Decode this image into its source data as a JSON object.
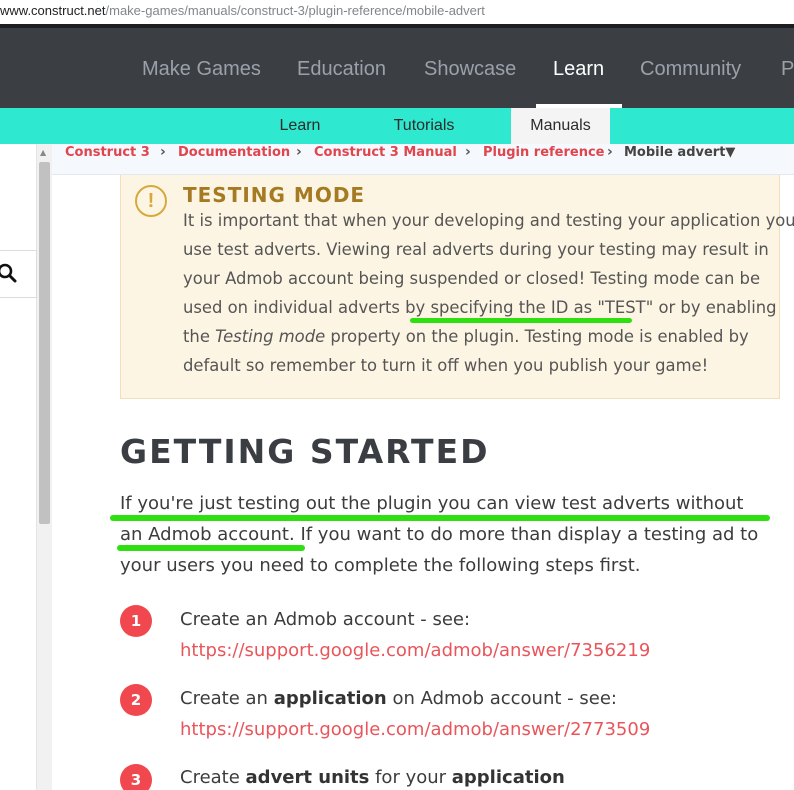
{
  "address_bar": {
    "domain": "www.construct.net",
    "path": "/make-games/manuals/construct-3/plugin-reference/mobile-advert"
  },
  "main_nav": {
    "items": [
      {
        "label": "Make Games"
      },
      {
        "label": "Education"
      },
      {
        "label": "Showcase"
      },
      {
        "label": "Learn"
      },
      {
        "label": "Community"
      },
      {
        "label": "P"
      }
    ],
    "active": "Learn"
  },
  "sub_nav": {
    "items": [
      {
        "label": "Learn"
      },
      {
        "label": "Tutorials"
      },
      {
        "label": "Manuals"
      }
    ],
    "active": "Manuals"
  },
  "breadcrumb": {
    "items": [
      {
        "label": "Construct 3"
      },
      {
        "label": "Documentation"
      },
      {
        "label": "Construct 3 Manual"
      },
      {
        "label": "Plugin reference"
      }
    ],
    "current": "Mobile advert▼"
  },
  "notice": {
    "icon": "!",
    "title": "TESTING MODE",
    "lines": [
      "It is important that when your developing and testing your application you",
      "use test adverts. Viewing real adverts during your testing may result in",
      "your Admob account being suspended or closed! Testing mode can be"
    ],
    "line4_a": "used on individual adverts by ",
    "line4_b": "specifying the ID as \"TEST\"",
    "line4_c": " or by enabling",
    "line5_a": "the ",
    "line5_em": "Testing mode",
    "line5_b": " property on the plugin. Testing mode is enabled by",
    "line6": "default so remember to turn it off when you publish your game!"
  },
  "getting_started": {
    "heading": "GETTING STARTED",
    "para_line1": "If you're just testing out the plugin you can view test adverts without",
    "para_line2_a": "an Admob account.",
    "para_line2_b": " If you want to do more than display a testing ad to",
    "para_line3": "your users you need to complete the following steps first."
  },
  "steps": [
    {
      "num": "1",
      "text_a": "Create an Admob account - see:",
      "link": "https://support.google.com/admob/answer/7356219"
    },
    {
      "num": "2",
      "text_a": "Create an ",
      "bold1": "application",
      "text_b": " on Admob account - see:",
      "link": "https://support.google.com/admob/answer/2773509"
    },
    {
      "num": "3",
      "text_a": "Create ",
      "bold1": "advert units",
      "text_b": " for your ",
      "bold2": "application"
    }
  ],
  "colors": {
    "nav_bg": "#3b3f44",
    "subnav_bg": "#2ee8cf",
    "accent_red": "#e0454d",
    "notice_bg": "#fdf5e3",
    "highlight_green": "#2fe010"
  },
  "icons": [
    "search-icon",
    "warning-icon",
    "dropdown-caret-icon",
    "chevron-right-icon"
  ]
}
